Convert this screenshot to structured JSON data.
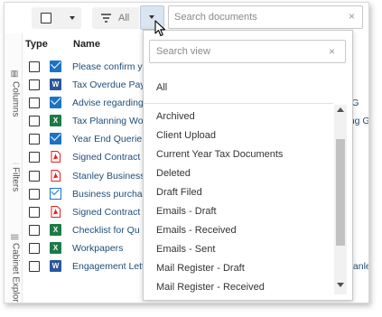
{
  "toolbar": {
    "filter_label": "All",
    "search_placeholder": "Search documents",
    "clear_glyph": "×"
  },
  "sidebar": {
    "tabs": [
      {
        "label": "Columns",
        "icon": "columns-icon"
      },
      {
        "label": "Filters",
        "icon": "filters-icon"
      },
      {
        "label": "Cabinet Explorer",
        "icon": "cabinet-icon"
      }
    ]
  },
  "table": {
    "columns": [
      "Type",
      "Name"
    ],
    "rows": [
      {
        "type": "email",
        "name": "Please confirm y",
        "extra": ""
      },
      {
        "type": "word",
        "name": "Tax Overdue Pay",
        "extra": ""
      },
      {
        "type": "email",
        "name": "Advise regarding",
        "extra": "L G"
      },
      {
        "type": "excel",
        "name": "Tax Planning Wo",
        "extra": "ring Gr"
      },
      {
        "type": "email",
        "name": "Year End Querie",
        "extra": ""
      },
      {
        "type": "pdf",
        "name": "Signed Contract",
        "extra": ""
      },
      {
        "type": "pdf",
        "name": "Stanley Business",
        "extra": ""
      },
      {
        "type": "email-outline",
        "name": "Business purcha",
        "extra": ""
      },
      {
        "type": "pdf",
        "name": "Signed Contract",
        "extra": ""
      },
      {
        "type": "excel",
        "name": "Checklist for Qu",
        "extra": ""
      },
      {
        "type": "excel",
        "name": "Workpapers",
        "extra": ""
      },
      {
        "type": "word",
        "name": "Engagement Letter",
        "extra": "Stanley Group"
      }
    ]
  },
  "view_dropdown": {
    "search_placeholder": "Search view",
    "all_label": "All",
    "items": [
      "Archived",
      "Client Upload",
      "Current Year Tax Documents",
      "Deleted",
      "Draft Filed",
      "Emails - Draft",
      "Emails - Received",
      "Emails - Sent",
      "Mail Register - Draft",
      "Mail Register - Received"
    ]
  },
  "colors": {
    "link": "#1f4e79",
    "email_icon": "#1a73c7",
    "word_icon": "#2b579a",
    "excel_icon": "#1d7a45",
    "pdf_icon": "#e02020",
    "active_button": "#dbe5f1"
  }
}
